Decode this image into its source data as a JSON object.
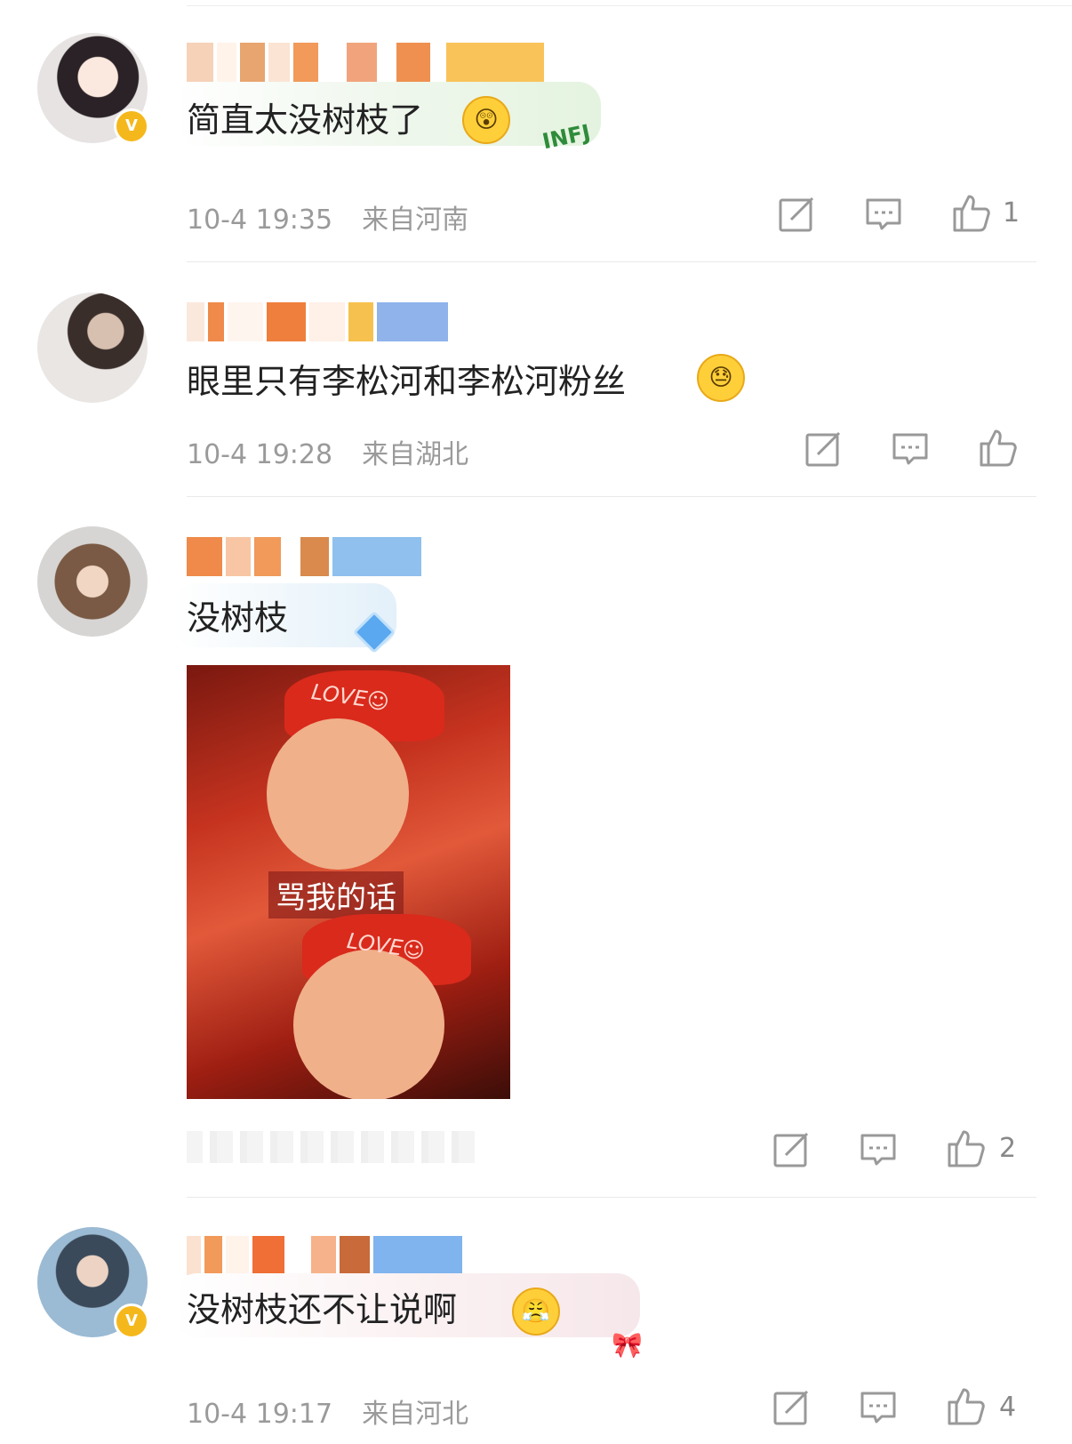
{
  "comments": [
    {
      "text": "简直太没树枝了",
      "emoji": "shocked-face",
      "time": "10-4 19:35",
      "location": "来自河南",
      "likes": "1",
      "verified": true,
      "sticker_text": "INFJ"
    },
    {
      "text": "眼里只有李松河和李松河粉丝",
      "emoji": "sweat-face",
      "time": "10-4 19:28",
      "location": "来自湖北",
      "likes": "",
      "verified": false
    },
    {
      "text": "没树枝",
      "time": "",
      "location": "",
      "likes": "2",
      "verified": false,
      "image_caption": "骂我的话",
      "image_hat_text": "LOVE☺"
    },
    {
      "text": "没树枝还不让说啊",
      "emoji": "annoyed-face",
      "time": "10-4 19:17",
      "location": "来自河北",
      "likes": "4",
      "verified": true
    }
  ],
  "colors": {
    "text": "#222222",
    "meta": "#9a9a9a",
    "verified_badge": "#f5b81c",
    "divider": "#e9e9e9",
    "icon": "#999999"
  },
  "icons": [
    "repost-icon",
    "comment-icon",
    "like-icon"
  ]
}
